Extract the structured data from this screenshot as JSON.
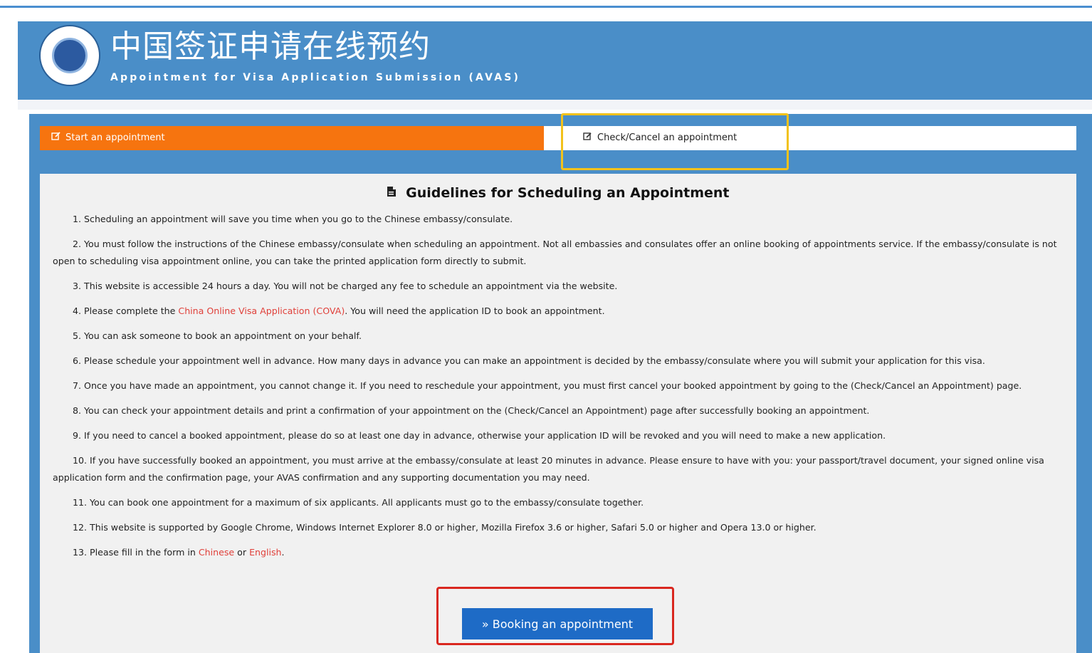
{
  "header": {
    "title": "中国签证申请在线预约",
    "subtitle": "Appointment for Visa Application Submission (AVAS)"
  },
  "tabs": {
    "start": "Start an appointment",
    "check": "Check/Cancel an appointment"
  },
  "guidelines": {
    "title": "Guidelines for Scheduling an Appointment",
    "items": [
      {
        "num": "1.",
        "text": "Scheduling an appointment will save you time when you go to the Chinese embassy/consulate."
      },
      {
        "num": "2.",
        "text": "You must follow the instructions of the Chinese embassy/consulate when scheduling an appointment. Not all embassies and consulates offer an online booking of appointments service. If the embassy/consulate is not open to scheduling visa appointment online, you can take the printed application form directly to submit."
      },
      {
        "num": "3.",
        "text": "This website is accessible 24 hours a day. You will not be charged any fee to schedule an appointment via the website."
      },
      {
        "num": "4.",
        "pre": "Please complete the ",
        "link": "China Online Visa Application (COVA)",
        "post": ". You will need the application ID to book an appointment."
      },
      {
        "num": "5.",
        "text": "You can ask someone to book an appointment on your behalf."
      },
      {
        "num": "6.",
        "text": "Please schedule your appointment well in advance. How many days in advance you can make an appointment is decided by the embassy/consulate where you will submit your application for this visa."
      },
      {
        "num": "7.",
        "text": "Once you have made an appointment, you cannot change it. If you need to reschedule your appointment, you must first cancel your booked appointment by going to the (Check/Cancel an Appointment) page."
      },
      {
        "num": "8.",
        "text": "You can check your appointment details and print a confirmation of your appointment on the (Check/Cancel an Appointment) page after successfully booking an appointment."
      },
      {
        "num": "9.",
        "text": "If you need to cancel a booked appointment, please do so at least one day in advance, otherwise your application ID will be revoked and you will need to make a new application."
      },
      {
        "num": "10.",
        "text": "If you have successfully booked an appointment, you must arrive at the embassy/consulate at least 20 minutes in advance. Please ensure to have with you: your passport/travel document, your signed online visa application form and the confirmation page, your AVAS confirmation and any supporting documentation you may need."
      },
      {
        "num": "11.",
        "text": "You can book one appointment for a maximum of six applicants. All applicants must go to the embassy/consulate together."
      },
      {
        "num": "12.",
        "text": "This website is supported by Google Chrome, Windows Internet Explorer 8.0 or higher, Mozilla Firefox 3.6 or higher, Safari 5.0 or higher and Opera 13.0 or higher."
      },
      {
        "num": "13.",
        "pre": "Please fill in the form in ",
        "link": "Chinese",
        "mid": " or ",
        "link2": "English",
        "post": "."
      }
    ]
  },
  "booking_button": "» Booking an appointment",
  "icons": {
    "start_tab": "edit-icon",
    "check_tab": "edit-box-icon",
    "guide": "document-icon"
  },
  "colors": {
    "header_blue": "#4a8ec8",
    "tab_orange": "#f6740f",
    "link_red": "#e0403a",
    "button_blue": "#1e6bc6"
  }
}
